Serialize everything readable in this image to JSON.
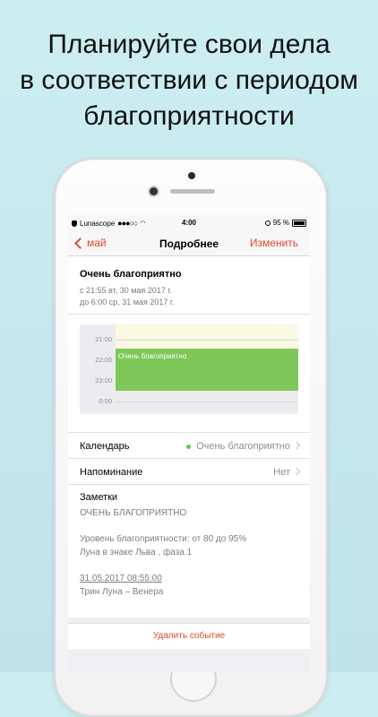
{
  "headline": {
    "line1": "Планируйте свои дела",
    "line2": "в соответствии с периодом",
    "line3": "благоприятности"
  },
  "status_bar": {
    "carrier": "Lunascope",
    "signal": "●●●○○",
    "time": "4:00",
    "battery": "95 %"
  },
  "nav": {
    "back_label": "май",
    "title": "Подробнее",
    "edit_label": "Изменить"
  },
  "event": {
    "title": "Очень благоприятно",
    "from": "с 21:55 вт, 30 мая 2017 г.",
    "to": "до 6:00 ср, 31 мая 2017 г."
  },
  "timeline": {
    "hours": [
      "21:00",
      "22:00",
      "23:00",
      "0:00"
    ],
    "event_label": "Очень благоприятно"
  },
  "rows": {
    "calendar_label": "Календарь",
    "calendar_value": "Очень благоприятно",
    "reminder_label": "Напоминание",
    "reminder_value": "Нет"
  },
  "notes": {
    "title": "Заметки",
    "line1": "ОЧЕНЬ БЛАГОПРИЯТНО",
    "line2": "Уровень благоприятности: от 80 до 95%",
    "line3": "Луна в знаке Льва , фаза 1",
    "date": "31.05.2017 08:55:00",
    "aspect": "Трин Луна – Венера"
  },
  "delete_label": "Удалить событие",
  "colors": {
    "accent": "#e4462f",
    "event_green": "#7ec758",
    "background": "#c4e8ee"
  }
}
